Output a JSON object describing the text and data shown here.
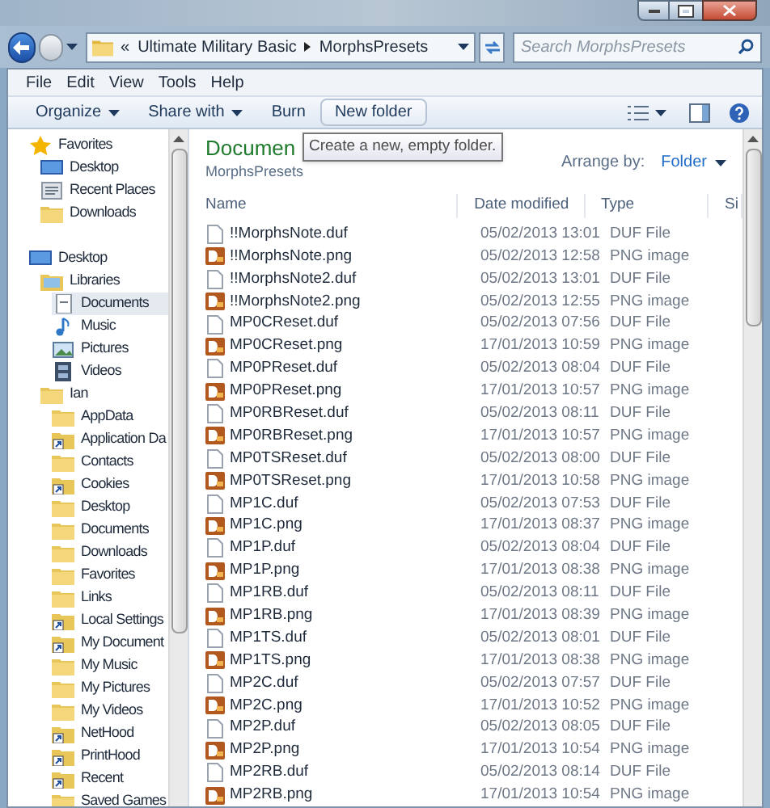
{
  "address_bar": {
    "overflow": "«",
    "crumbs": [
      "Ultimate Military Basic",
      "MorphsPresets"
    ]
  },
  "search": {
    "placeholder": "Search MorphsPresets"
  },
  "menu": [
    "File",
    "Edit",
    "View",
    "Tools",
    "Help"
  ],
  "commands": [
    {
      "label": "Organize",
      "dropdown": true,
      "hovered": false
    },
    {
      "label": "Share with",
      "dropdown": true,
      "hovered": false
    },
    {
      "label": "Burn",
      "dropdown": false,
      "hovered": false
    },
    {
      "label": "New folder",
      "dropdown": false,
      "hovered": true
    }
  ],
  "tooltip": "Create a new, empty folder.",
  "nav": [
    {
      "label": "Favorites",
      "kind": "star",
      "selected": false,
      "children": [
        {
          "label": "Desktop",
          "kind": "desktop",
          "selected": false
        },
        {
          "label": "Recent Places",
          "kind": "recent",
          "selected": false
        },
        {
          "label": "Downloads",
          "kind": "folder",
          "selected": false
        }
      ]
    },
    {
      "label": "Desktop",
      "kind": "desktop",
      "selected": false,
      "children": [
        {
          "label": "Libraries",
          "kind": "library",
          "selected": false,
          "children": [
            {
              "label": "Documents",
              "kind": "document",
              "selected": true
            },
            {
              "label": "Music",
              "kind": "music",
              "selected": false
            },
            {
              "label": "Pictures",
              "kind": "pictures",
              "selected": false
            },
            {
              "label": "Videos",
              "kind": "videos",
              "selected": false
            }
          ]
        },
        {
          "label": "Ian",
          "kind": "folder",
          "selected": false,
          "children": [
            {
              "label": "AppData",
              "kind": "folder",
              "selected": false
            },
            {
              "label": "Application Da",
              "kind": "shortcut",
              "selected": false
            },
            {
              "label": "Contacts",
              "kind": "folder",
              "selected": false
            },
            {
              "label": "Cookies",
              "kind": "shortcut",
              "selected": false
            },
            {
              "label": "Desktop",
              "kind": "folder",
              "selected": false
            },
            {
              "label": "Documents",
              "kind": "folder",
              "selected": false
            },
            {
              "label": "Downloads",
              "kind": "folder",
              "selected": false
            },
            {
              "label": "Favorites",
              "kind": "folder",
              "selected": false
            },
            {
              "label": "Links",
              "kind": "folder",
              "selected": false
            },
            {
              "label": "Local Settings",
              "kind": "shortcut",
              "selected": false
            },
            {
              "label": "My Document",
              "kind": "shortcut",
              "selected": false
            },
            {
              "label": "My Music",
              "kind": "folder",
              "selected": false
            },
            {
              "label": "My Pictures",
              "kind": "folder",
              "selected": false
            },
            {
              "label": "My Videos",
              "kind": "folder",
              "selected": false
            },
            {
              "label": "NetHood",
              "kind": "shortcut",
              "selected": false
            },
            {
              "label": "PrintHood",
              "kind": "shortcut",
              "selected": false
            },
            {
              "label": "Recent",
              "kind": "shortcut",
              "selected": false
            },
            {
              "label": "Saved Games",
              "kind": "folder",
              "selected": false
            }
          ]
        }
      ]
    }
  ],
  "content": {
    "heading": "Documen",
    "subtitle": "MorphsPresets",
    "arrange_label": "Arrange by:",
    "arrange_value": "Folder"
  },
  "table": {
    "columns": [
      "Name",
      "Date modified",
      "Type",
      "Si"
    ],
    "rows": [
      {
        "kind": "duf",
        "name": "!!MorphsNote.duf",
        "date": "05/02/2013 13:01",
        "type": "DUF File"
      },
      {
        "kind": "png",
        "name": "!!MorphsNote.png",
        "date": "05/02/2013 12:58",
        "type": "PNG image"
      },
      {
        "kind": "duf",
        "name": "!!MorphsNote2.duf",
        "date": "05/02/2013 13:01",
        "type": "DUF File"
      },
      {
        "kind": "png",
        "name": "!!MorphsNote2.png",
        "date": "05/02/2013 12:55",
        "type": "PNG image"
      },
      {
        "kind": "duf",
        "name": "MP0CReset.duf",
        "date": "05/02/2013 07:56",
        "type": "DUF File"
      },
      {
        "kind": "png",
        "name": "MP0CReset.png",
        "date": "17/01/2013 10:59",
        "type": "PNG image"
      },
      {
        "kind": "duf",
        "name": "MP0PReset.duf",
        "date": "05/02/2013 08:04",
        "type": "DUF File"
      },
      {
        "kind": "png",
        "name": "MP0PReset.png",
        "date": "17/01/2013 10:57",
        "type": "PNG image"
      },
      {
        "kind": "duf",
        "name": "MP0RBReset.duf",
        "date": "05/02/2013 08:11",
        "type": "DUF File"
      },
      {
        "kind": "png",
        "name": "MP0RBReset.png",
        "date": "17/01/2013 10:57",
        "type": "PNG image"
      },
      {
        "kind": "duf",
        "name": "MP0TSReset.duf",
        "date": "05/02/2013 08:00",
        "type": "DUF File"
      },
      {
        "kind": "png",
        "name": "MP0TSReset.png",
        "date": "17/01/2013 10:58",
        "type": "PNG image"
      },
      {
        "kind": "duf",
        "name": "MP1C.duf",
        "date": "05/02/2013 07:53",
        "type": "DUF File"
      },
      {
        "kind": "png",
        "name": "MP1C.png",
        "date": "17/01/2013 08:37",
        "type": "PNG image"
      },
      {
        "kind": "duf",
        "name": "MP1P.duf",
        "date": "05/02/2013 08:04",
        "type": "DUF File"
      },
      {
        "kind": "png",
        "name": "MP1P.png",
        "date": "17/01/2013 08:38",
        "type": "PNG image"
      },
      {
        "kind": "duf",
        "name": "MP1RB.duf",
        "date": "05/02/2013 08:11",
        "type": "DUF File"
      },
      {
        "kind": "png",
        "name": "MP1RB.png",
        "date": "17/01/2013 08:39",
        "type": "PNG image"
      },
      {
        "kind": "duf",
        "name": "MP1TS.duf",
        "date": "05/02/2013 08:01",
        "type": "DUF File"
      },
      {
        "kind": "png",
        "name": "MP1TS.png",
        "date": "17/01/2013 08:38",
        "type": "PNG image"
      },
      {
        "kind": "duf",
        "name": "MP2C.duf",
        "date": "05/02/2013 07:57",
        "type": "DUF File"
      },
      {
        "kind": "png",
        "name": "MP2C.png",
        "date": "17/01/2013 10:52",
        "type": "PNG image"
      },
      {
        "kind": "duf",
        "name": "MP2P.duf",
        "date": "05/02/2013 08:05",
        "type": "DUF File"
      },
      {
        "kind": "png",
        "name": "MP2P.png",
        "date": "17/01/2013 10:54",
        "type": "PNG image"
      },
      {
        "kind": "duf",
        "name": "MP2RB.duf",
        "date": "05/02/2013 08:14",
        "type": "DUF File"
      },
      {
        "kind": "png",
        "name": "MP2RB.png",
        "date": "17/01/2013 10:54",
        "type": "PNG image"
      }
    ]
  }
}
